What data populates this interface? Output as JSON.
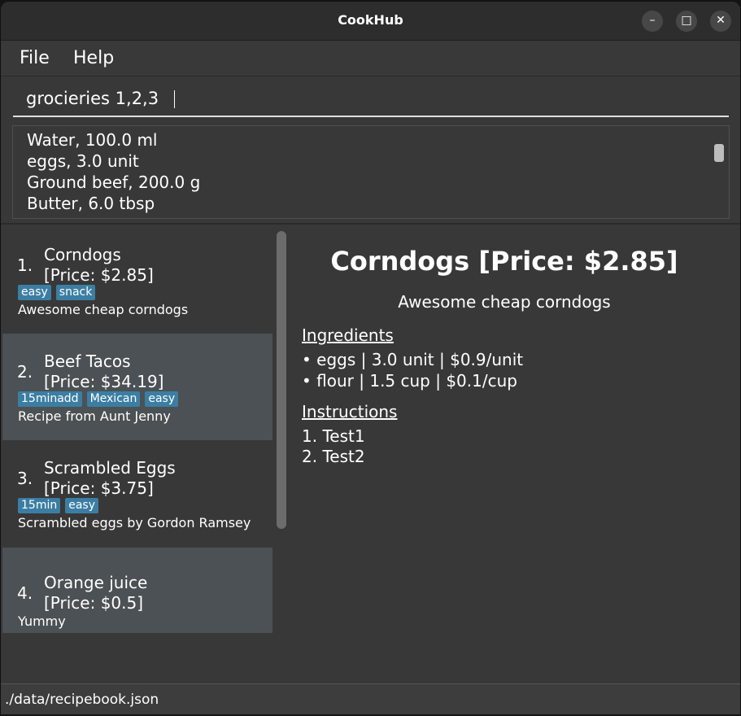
{
  "window": {
    "title": "CookHub"
  },
  "menu": {
    "file": "File",
    "help": "Help"
  },
  "command": {
    "value": "grocieries 1,2,3"
  },
  "result": {
    "lines": [
      "Water, 100.0 ml",
      "eggs, 3.0 unit",
      "Ground beef, 200.0 g",
      "Butter, 6.0 tbsp"
    ]
  },
  "recipes": [
    {
      "index": "1.",
      "name": "Corndogs",
      "price": "[Price: $2.85]",
      "tags": [
        "easy",
        "snack"
      ],
      "description": "Awesome cheap corndogs"
    },
    {
      "index": "2.",
      "name": "Beef Tacos",
      "price": "[Price: $34.19]",
      "tags": [
        "15minadd",
        "Mexican",
        "easy"
      ],
      "description": "Recipe from Aunt Jenny"
    },
    {
      "index": "3.",
      "name": "Scrambled Eggs",
      "price": "[Price: $3.75]",
      "tags": [
        "15min",
        "easy"
      ],
      "description": "Scrambled eggs by Gordon Ramsey"
    },
    {
      "index": "4.",
      "name": "Orange juice",
      "price": "[Price: $0.5]",
      "tags": [],
      "description": "Yummy"
    }
  ],
  "detail": {
    "title": "Corndogs [Price: $2.85]",
    "description": "Awesome cheap corndogs",
    "ingredients_header": "Ingredients",
    "ingredients": [
      "•  eggs | 3.0 unit | $0.9/unit",
      "•  flour | 1.5 cup | $0.1/cup"
    ],
    "instructions_header": "Instructions",
    "instructions": [
      "1.  Test1",
      "2.  Test2"
    ]
  },
  "status": {
    "path": "./data/recipebook.json"
  },
  "colors": {
    "tag_bg": "#3c7ea3",
    "selected_card_bg": "#4b5154",
    "panel_bg": "#383838"
  }
}
